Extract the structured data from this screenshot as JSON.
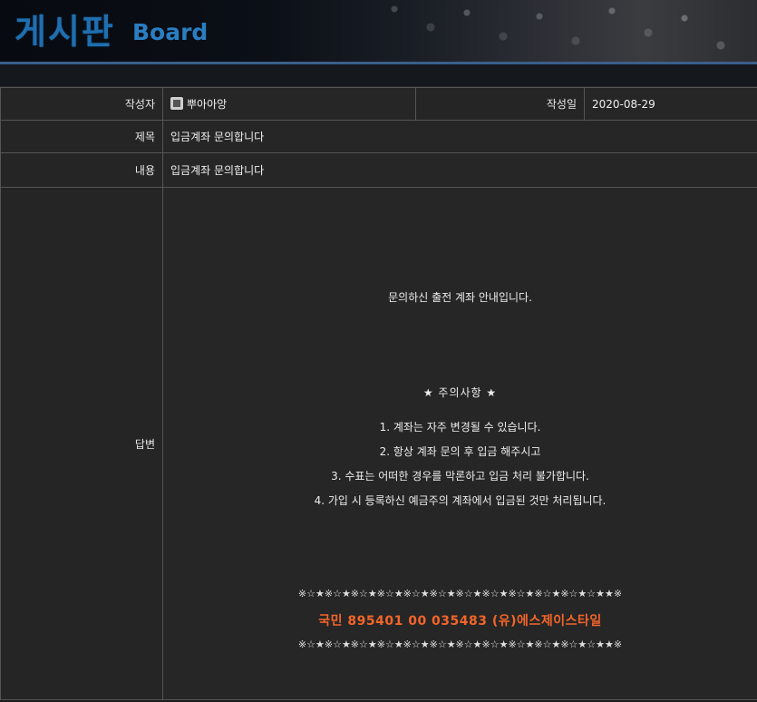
{
  "header": {
    "title_ko": "게시판",
    "title_en": "Board"
  },
  "post": {
    "author_label": "작성자",
    "author_value": "뿌아아앙",
    "date_label": "작성일",
    "date_value": "2020-08-29",
    "subject_label": "제목",
    "subject_value": "입금계좌 문의합니다",
    "content_label": "내용",
    "content_value": "입금계좌 문의합니다",
    "answer_label": "답변"
  },
  "answer": {
    "intro": "문의하신 출전 계좌 안내입니다.",
    "notice_title": "★ 주의사항 ★",
    "notices": [
      "1. 계좌는 자주 변경될 수 있습니다.",
      "2. 항상 계좌 문의 후 입금 해주시고",
      "3. 수표는 어떠한 경우를 막론하고 입금 처리 불가합니다.",
      "4. 가입 시 등록하신 예금주의 계좌에서 입금된 것만 처리됩니다."
    ],
    "decor_line": "※☆★※☆★※☆★※☆★※☆★※☆★※☆★※☆★※☆★※☆★※☆★☆★★※",
    "account": "국민 895401 00 035483 (유)에스제이스타일",
    "account_color": "#f2652a"
  }
}
